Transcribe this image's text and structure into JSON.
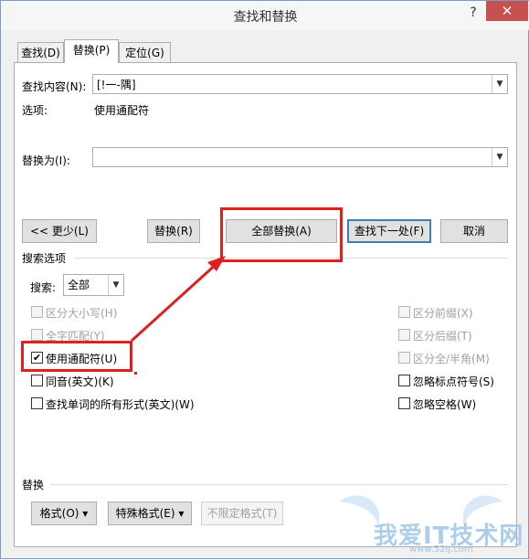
{
  "window": {
    "title": "查找和替换",
    "help": "?",
    "close": "✕"
  },
  "tabs": [
    "查找(D)",
    "替换(P)",
    "定位(G)"
  ],
  "find": {
    "label": "查找内容(N):",
    "value": "[!一-隅]"
  },
  "options_line": {
    "label": "选项:",
    "value": "使用通配符"
  },
  "replace": {
    "label": "替换为(I):",
    "value": ""
  },
  "buttons": {
    "less": "<< 更少(L)",
    "replace": "替换(R)",
    "replace_all": "全部替换(A)",
    "find_next": "查找下一处(F)",
    "cancel": "取消"
  },
  "search_options": {
    "title": "搜索选项",
    "search_label": "搜索:",
    "search_value": "全部",
    "left_checks": [
      {
        "label": "区分大小写(H)",
        "checked": false,
        "disabled": true
      },
      {
        "label": "全字匹配(Y)",
        "checked": false,
        "disabled": true
      },
      {
        "label": "使用通配符(U)",
        "checked": true,
        "disabled": false
      },
      {
        "label": "同音(英文)(K)",
        "checked": false,
        "disabled": false
      },
      {
        "label": "查找单词的所有形式(英文)(W)",
        "checked": false,
        "disabled": false
      }
    ],
    "right_checks": [
      {
        "label": "区分前缀(X)",
        "checked": false,
        "disabled": true
      },
      {
        "label": "区分后缀(T)",
        "checked": false,
        "disabled": true
      },
      {
        "label": "区分全/半角(M)",
        "checked": false,
        "disabled": true
      },
      {
        "label": "忽略标点符号(S)",
        "checked": false,
        "disabled": false
      },
      {
        "label": "忽略空格(W)",
        "checked": false,
        "disabled": false
      }
    ]
  },
  "replace_section": {
    "title": "替换",
    "format": "格式(O) ▾",
    "special": "特殊格式(E) ▾",
    "no_format": "不限定格式(T)"
  },
  "watermark": {
    "text": "我爱IT技术网",
    "url": "www.52ij.com"
  },
  "colors": {
    "annotation": "#e02020",
    "accent": "#3c7fb1"
  }
}
